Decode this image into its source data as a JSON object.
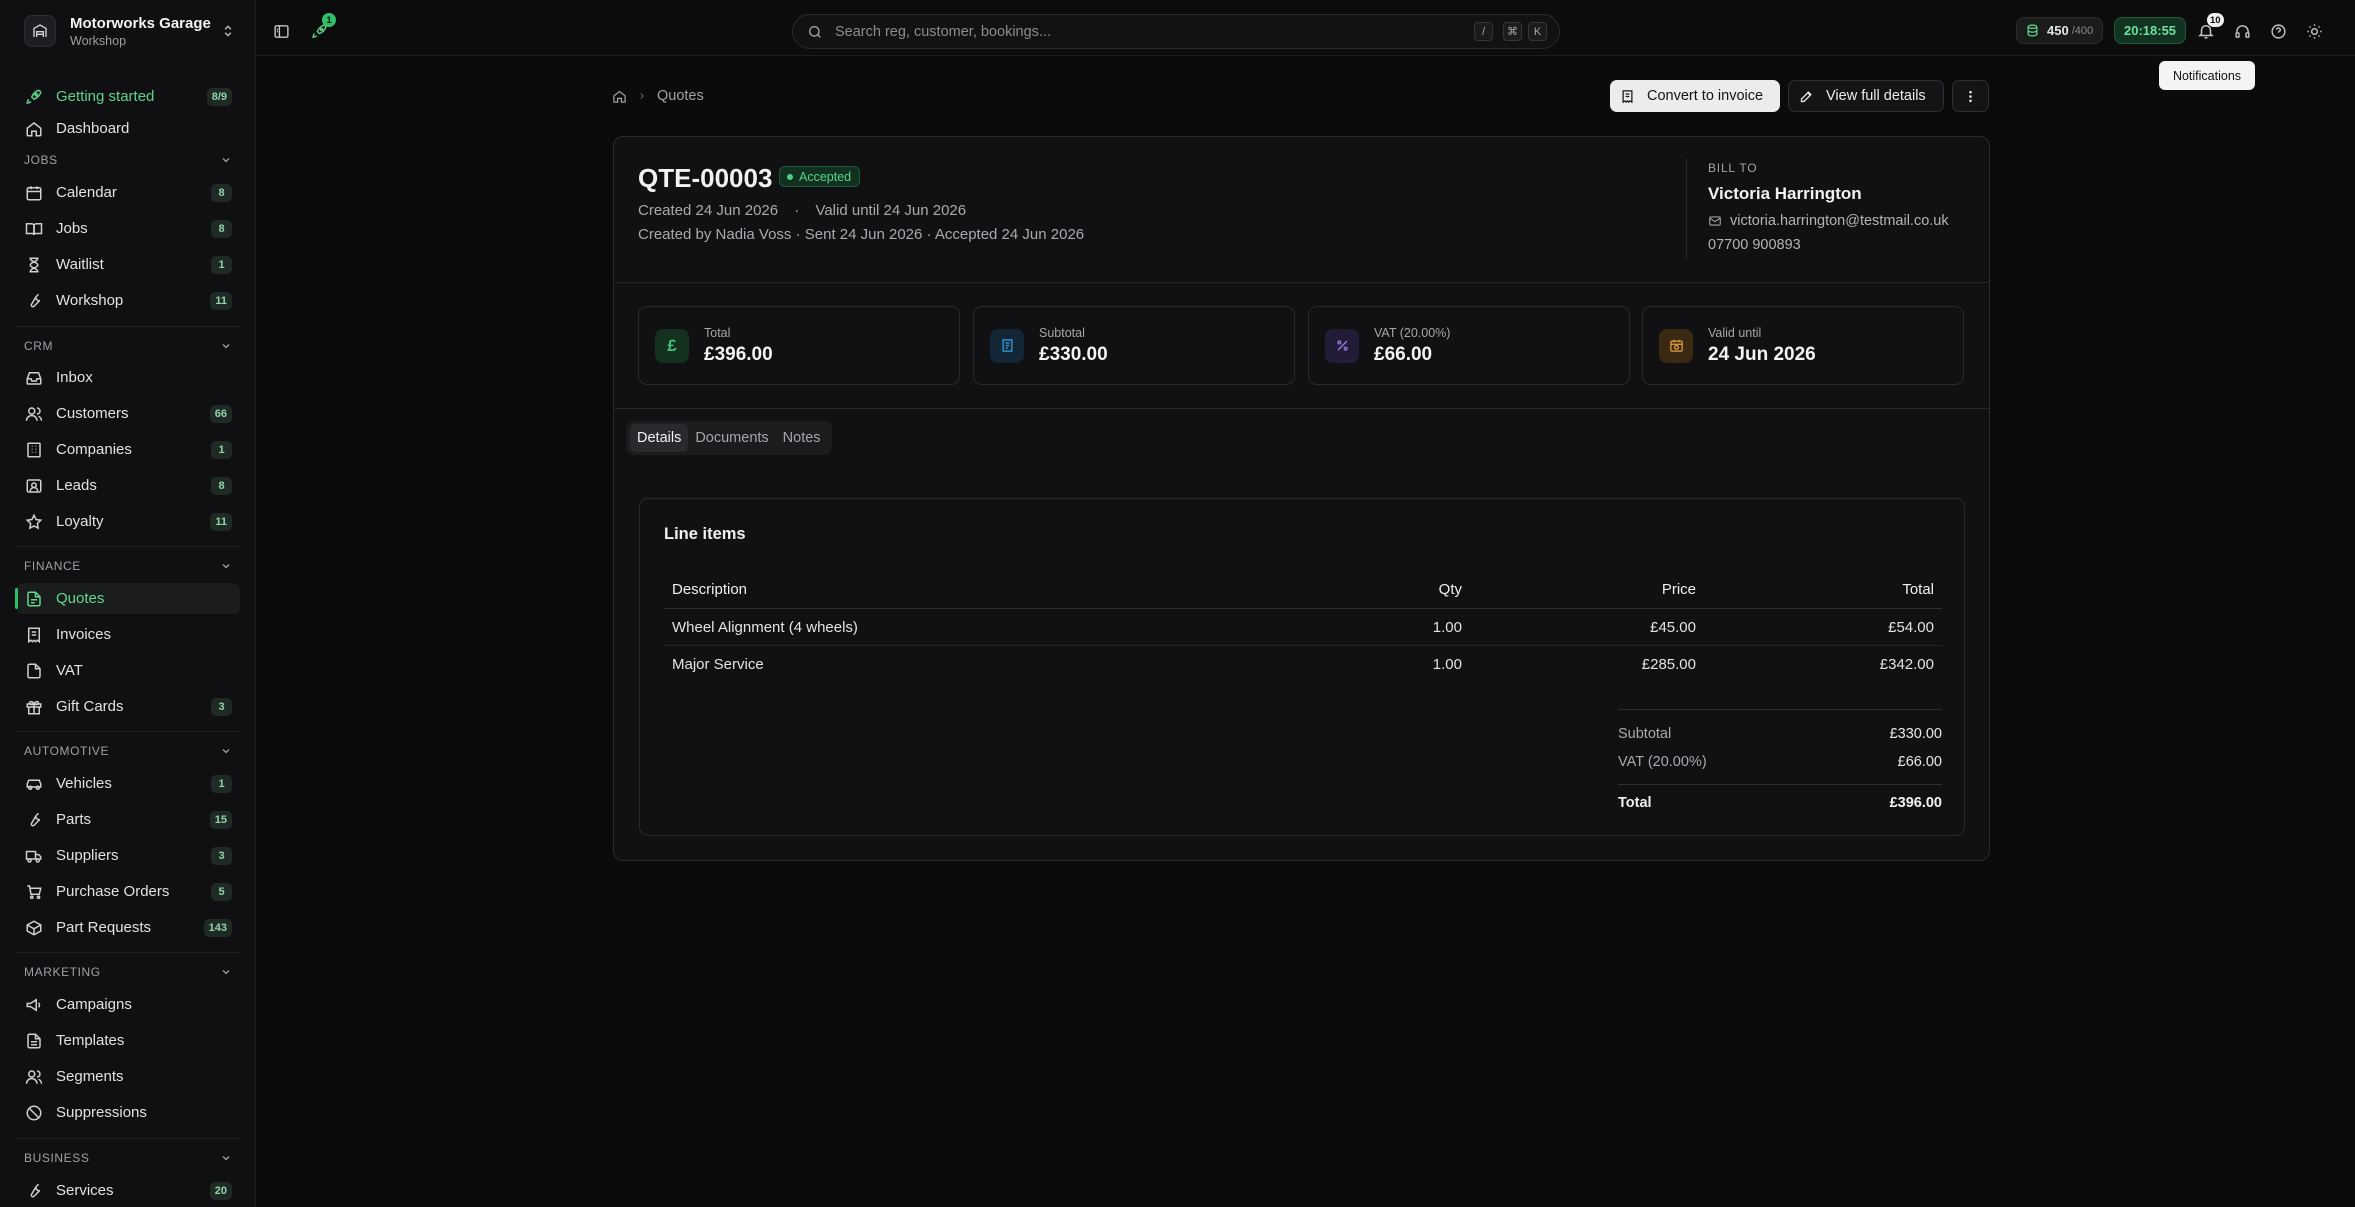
{
  "workspace": {
    "name": "Motorworks Garage",
    "subtitle": "Workshop"
  },
  "sidebar": {
    "getting_started": {
      "label": "Getting started",
      "badge": "8/9"
    },
    "dashboard": {
      "label": "Dashboard"
    },
    "sections": {
      "jobs": "JOBS",
      "crm": "CRM",
      "finance": "FINANCE",
      "automotive": "AUTOMOTIVE",
      "marketing": "MARKETING",
      "business": "BUSINESS"
    },
    "items": {
      "calendar": {
        "label": "Calendar",
        "badge": "8"
      },
      "jobs": {
        "label": "Jobs",
        "badge": "8"
      },
      "waitlist": {
        "label": "Waitlist",
        "badge": "1"
      },
      "workshop": {
        "label": "Workshop",
        "badge": "11"
      },
      "inbox": {
        "label": "Inbox"
      },
      "customers": {
        "label": "Customers",
        "badge": "66"
      },
      "companies": {
        "label": "Companies",
        "badge": "1"
      },
      "leads": {
        "label": "Leads",
        "badge": "8"
      },
      "loyalty": {
        "label": "Loyalty",
        "badge": "11"
      },
      "quotes": {
        "label": "Quotes"
      },
      "invoices": {
        "label": "Invoices"
      },
      "vat": {
        "label": "VAT"
      },
      "gift_cards": {
        "label": "Gift Cards",
        "badge": "3"
      },
      "vehicles": {
        "label": "Vehicles",
        "badge": "1"
      },
      "parts": {
        "label": "Parts",
        "badge": "15"
      },
      "suppliers": {
        "label": "Suppliers",
        "badge": "3"
      },
      "purchase_orders": {
        "label": "Purchase Orders",
        "badge": "5"
      },
      "part_requests": {
        "label": "Part Requests",
        "badge": "143"
      },
      "campaigns": {
        "label": "Campaigns"
      },
      "templates": {
        "label": "Templates"
      },
      "segments": {
        "label": "Segments"
      },
      "suppressions": {
        "label": "Suppressions"
      },
      "services": {
        "label": "Services",
        "badge": "20"
      }
    }
  },
  "topbar": {
    "rocket_badge": "1",
    "search_placeholder": "Search reg, customer, bookings...",
    "shortcut_keys": [
      "/",
      "⌘",
      "K"
    ],
    "credits_value": "450",
    "credits_max": "/400",
    "clock": "20:18:55",
    "notifications_badge": "10",
    "tooltip": "Notifications"
  },
  "breadcrumb": {
    "current": "Quotes"
  },
  "actions": {
    "convert": "Convert to invoice",
    "view_details": "View full details"
  },
  "quote": {
    "number": "QTE-00003",
    "status": "Accepted",
    "created": "Created 24 Jun 2026",
    "dot_sep": "·",
    "valid_until_text": "Valid until 24 Jun 2026",
    "created_by_line": "Created by Nadia Voss · Sent 24 Jun 2026 · Accepted 24 Jun 2026"
  },
  "bill_to": {
    "caption": "BILL TO",
    "name": "Victoria Harrington",
    "email": "victoria.harrington@testmail.co.uk",
    "phone": "07700 900893"
  },
  "stats": [
    {
      "label": "Total",
      "value": "£396.00",
      "icon": "pound-icon",
      "color": "#3fbf7a"
    },
    {
      "label": "Subtotal",
      "value": "£330.00",
      "icon": "receipt-icon",
      "color": "#3b9ee6"
    },
    {
      "label": "VAT (20.00%)",
      "value": "£66.00",
      "icon": "percent-icon",
      "color": "#9a7ae6"
    },
    {
      "label": "Valid until",
      "value": "24 Jun 2026",
      "icon": "calendar-clock-icon",
      "color": "#e6a03b"
    }
  ],
  "tabs": [
    "Details",
    "Documents",
    "Notes"
  ],
  "line_items": {
    "title": "Line items",
    "columns": {
      "description": "Description",
      "qty": "Qty",
      "price": "Price",
      "total": "Total"
    },
    "rows": [
      {
        "description": "Wheel Alignment (4 wheels)",
        "qty": "1.00",
        "price": "£45.00",
        "total": "£54.00"
      },
      {
        "description": "Major Service",
        "qty": "1.00",
        "price": "£285.00",
        "total": "£342.00"
      }
    ],
    "summary": {
      "subtotal_label": "Subtotal",
      "subtotal": "£330.00",
      "vat_label": "VAT (20.00%)",
      "vat": "£66.00",
      "total_label": "Total",
      "total": "£396.00"
    }
  },
  "colors": {
    "accent": "#2fbf68",
    "background": "#0b0b0c"
  }
}
